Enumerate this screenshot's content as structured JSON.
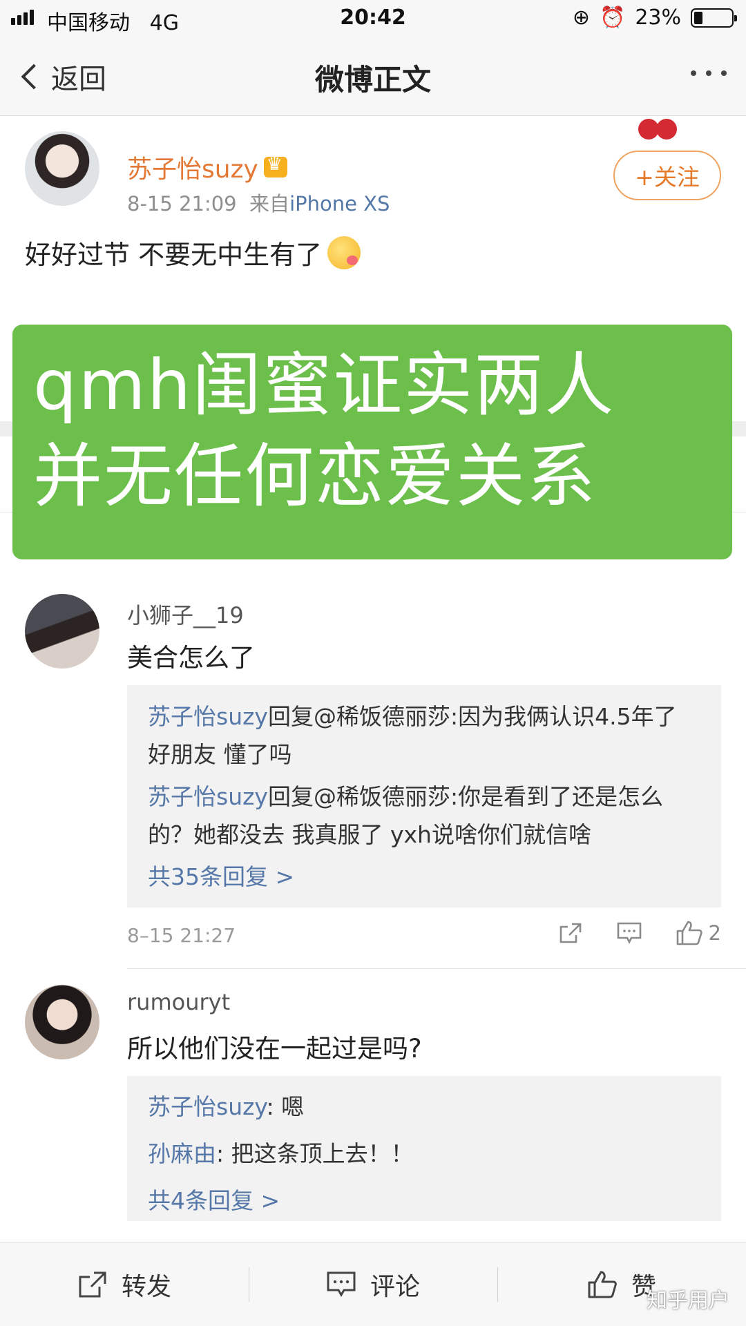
{
  "status_bar": {
    "carrier": "中国移动",
    "network": "4G",
    "time": "20:42",
    "battery": "23%"
  },
  "nav": {
    "back_label": "返回",
    "title": "微博正文"
  },
  "post": {
    "author": "苏子怡suzy",
    "time": "8-15 21:09",
    "source_prefix": "来自",
    "source": "iPhone XS",
    "follow_label": "+关注",
    "text": "好好过节 不要无中生有了"
  },
  "banner": {
    "line1": "qmh闺蜜证实两人",
    "line2": "并无任何恋爱关系"
  },
  "comments": [
    {
      "user": "小狮子__19",
      "text": "美合怎么了",
      "replies": [
        {
          "name": "苏子怡suzy",
          "text": "回复@稀饭德丽莎:因为我俩认识4.5年了 好朋友 懂了吗"
        },
        {
          "name": "苏子怡suzy",
          "text": "回复@稀饭德丽莎:你是看到了还是怎么的？她都没去 我真服了 yxh说啥你们就信啥"
        }
      ],
      "more_replies": "共35条回复 >",
      "time": "8–15 21:27",
      "likes": "2"
    },
    {
      "user": "rumouryt",
      "text": "所以他们没在一起过是吗?",
      "replies": [
        {
          "name": "苏子怡suzy",
          "text": ": 嗯"
        },
        {
          "name": "孙麻由",
          "text": ": 把这条顶上去！！"
        }
      ],
      "more_replies": "共4条回复 >"
    }
  ],
  "toolbar": {
    "repost": "转发",
    "comment": "评论",
    "like": "赞"
  },
  "watermark": "知乎用户",
  "icons": {
    "back": "chevron-left-icon",
    "more": "more-dots-icon",
    "share": "share-icon",
    "comment": "comment-icon",
    "like": "thumbs-up-icon"
  },
  "colors": {
    "author_orange": "#e47935",
    "link_blue": "#5678a8",
    "banner_green": "#6cbf4b"
  }
}
